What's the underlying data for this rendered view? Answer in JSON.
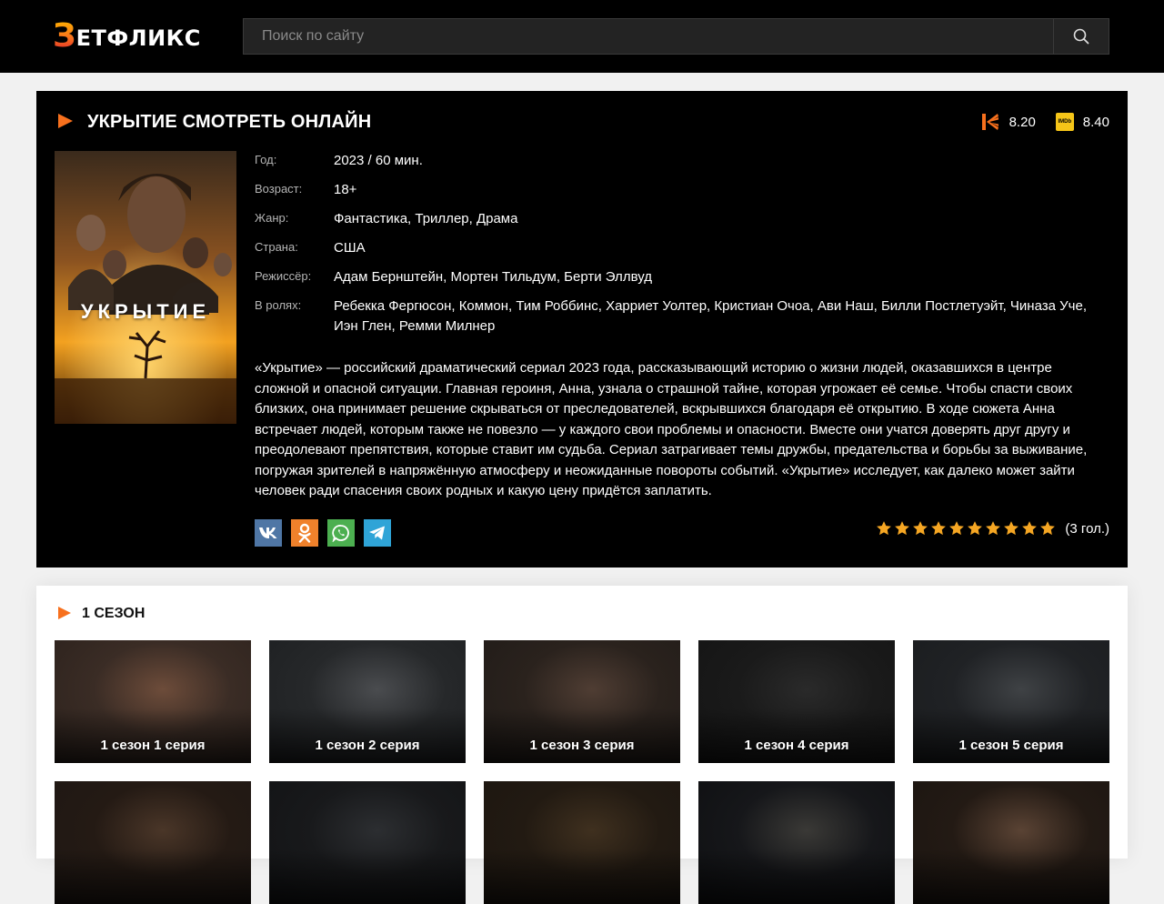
{
  "header": {
    "logo_first": "З",
    "logo_rest": "ЕТФЛИКС",
    "search_placeholder": "Поиск по сайту"
  },
  "film": {
    "title": "Укрытие смотреть онлайн",
    "ratings": [
      {
        "source": "kinopoisk",
        "value": "8.20"
      },
      {
        "source": "imdb",
        "value": "8.40"
      }
    ],
    "poster_title": "УКРЫТИЕ",
    "info": [
      {
        "label": "Год:",
        "value": "2023 / 60 мин."
      },
      {
        "label": "Возраст:",
        "value": "18+"
      },
      {
        "label": "Жанр:",
        "value": "Фантастика, Триллер, Драма"
      },
      {
        "label": "Страна:",
        "value": "США"
      },
      {
        "label": "Режиссёр:",
        "value": "Адам Бернштейн, Мортен Тильдум, Берти Эллвуд"
      },
      {
        "label": "В ролях:",
        "value": "Ребекка Фергюсон, Коммон, Тим Роббинс, Харриет Уолтер, Кристиан Очоа, Ави Наш, Билли Постлетуэйт, Чиназа Уче, Иэн Глен, Ремми Милнер"
      }
    ],
    "description": "«Укрытие» — российский драматический сериал 2023 года, рассказывающий историю о жизни людей, оказавшихся в центре сложной и опасной ситуации. Главная героиня, Анна, узнала о страшной тайне, которая угрожает её семье. Чтобы спасти своих близких, она принимает решение скрываться от преследователей, вскрывшихся благодаря её открытию. В ходе сюжета Анна встречает людей, которым также не повезло — у каждого свои проблемы и опасности. Вместе они учатся доверять друг другу и преодолевают препятствия, которые ставит им судьба. Сериал затрагивает темы дружбы, предательства и борьбы за выживание, погружая зрителей в напряжённую атмосферу и неожиданные повороты событий. «Укрытие» исследует, как далеко может зайти человек ради спасения своих родных и какую цену придётся заплатить.",
    "share": [
      "vk-icon",
      "odnoklassniki-icon",
      "whatsapp-icon",
      "telegram-icon"
    ],
    "stars_filled": 10,
    "votes": "(3 гол.)"
  },
  "season": {
    "title": "1 СЕЗОН",
    "episodes": [
      {
        "label": "1 сезон 1 серия"
      },
      {
        "label": "1 сезон 2 серия"
      },
      {
        "label": "1 сезон 3 серия"
      },
      {
        "label": "1 сезон 4 серия"
      },
      {
        "label": "1 сезон 5 серия"
      },
      {
        "label": ""
      },
      {
        "label": ""
      },
      {
        "label": ""
      },
      {
        "label": ""
      },
      {
        "label": ""
      }
    ]
  },
  "colors": {
    "accent": "#f7701d",
    "imdb": "#f5c518",
    "star": "#f5a623"
  }
}
